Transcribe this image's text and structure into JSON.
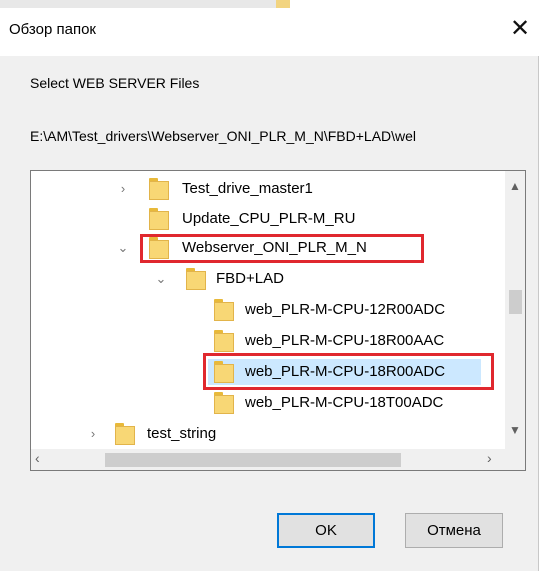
{
  "window": {
    "title": "Обзор папок"
  },
  "description": "Select WEB SERVER Files",
  "path": "E:\\AM\\Test_drivers\\Webserver_ONI_PLR_M_N\\FBD+LAD\\wel",
  "tree": {
    "rows": [
      {
        "label": "Test_drive_master1",
        "expander": "›"
      },
      {
        "label": "Update_CPU_PLR-M_RU",
        "expander": ""
      },
      {
        "label": "Webserver_ONI_PLR_M_N",
        "expander": "⌄"
      },
      {
        "label": "FBD+LAD",
        "expander": "⌄"
      },
      {
        "label": "web_PLR-M-CPU-12R00ADC",
        "expander": ""
      },
      {
        "label": "web_PLR-M-CPU-18R00AAC",
        "expander": ""
      },
      {
        "label": "web_PLR-M-CPU-18R00ADC",
        "expander": "",
        "selected": true
      },
      {
        "label": "web_PLR-M-CPU-18T00ADC",
        "expander": ""
      },
      {
        "label": "test_string",
        "expander": "›"
      }
    ]
  },
  "buttons": {
    "ok": "OK",
    "cancel": "Отмена"
  },
  "colors": {
    "highlight": "#e0282e",
    "selection": "#cce8ff",
    "folder": "#f8d775"
  }
}
